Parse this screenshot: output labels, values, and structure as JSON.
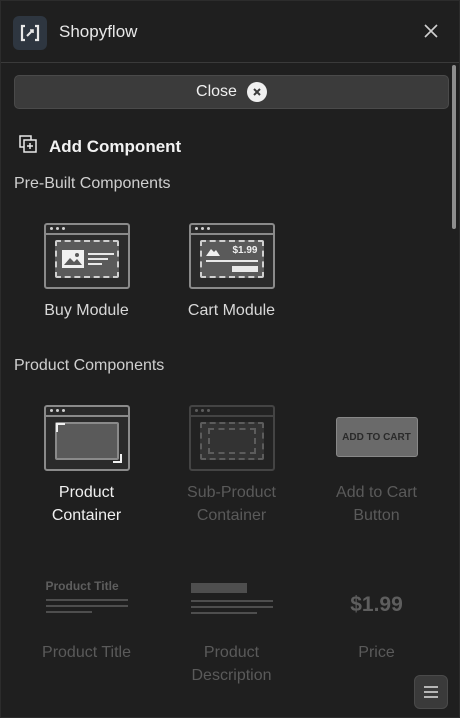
{
  "header": {
    "title": "Shopyflow",
    "logo_icon": "bracket-logo-icon",
    "close_icon": "close-icon"
  },
  "close_button": {
    "label": "Close",
    "icon": "close-circle-icon"
  },
  "add_component": {
    "label": "Add Component",
    "icon": "add-square-icon"
  },
  "prebuilt": {
    "label": "Pre-Built Components",
    "items": [
      {
        "label": "Buy Module",
        "art_price": ""
      },
      {
        "label": "Cart Module",
        "art_price": "$1.99"
      }
    ]
  },
  "product": {
    "label": "Product Components",
    "items": [
      {
        "label_1": "Product",
        "label_2": "Container",
        "enabled": true
      },
      {
        "label_1": "Sub-Product",
        "label_2": "Container",
        "enabled": false
      },
      {
        "label_1": "Add to Cart",
        "label_2": "Button",
        "enabled": false,
        "art_text": "ADD TO CART"
      },
      {
        "label_1": "Product Title",
        "label_2": "",
        "enabled": false,
        "art_text": "Product Title"
      },
      {
        "label_1": "Product",
        "label_2": "Description",
        "enabled": false
      },
      {
        "label_1": "Price",
        "label_2": "",
        "enabled": false,
        "art_text": "$1.99"
      }
    ]
  },
  "footer": {
    "menu_icon": "menu-icon"
  },
  "colors": {
    "panel": "#1f1f1f",
    "button": "#3b3b3b",
    "text": "#e6e6e6",
    "muted": "#5a5a5a"
  }
}
